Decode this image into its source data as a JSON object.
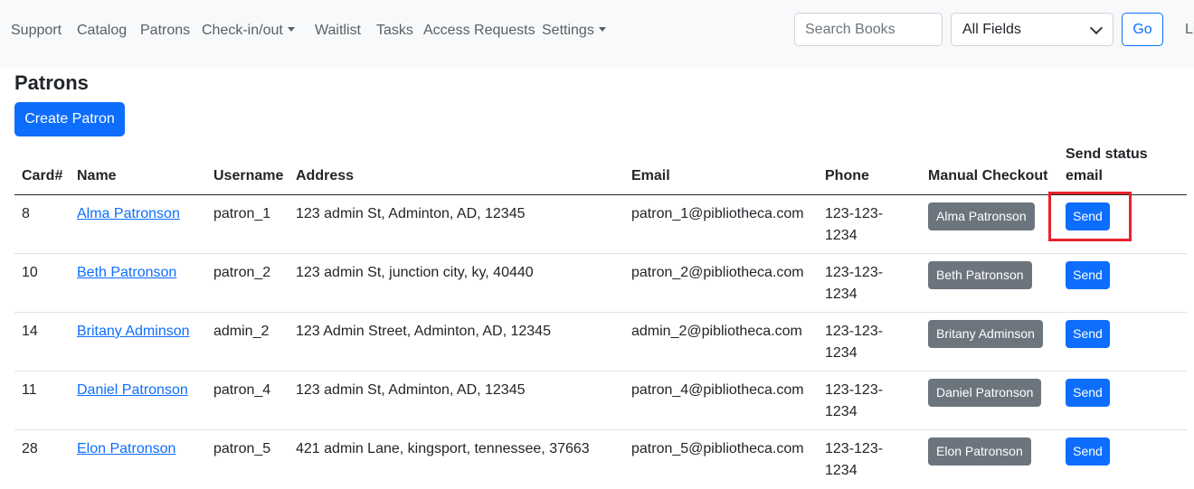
{
  "navbar": {
    "items": [
      {
        "label": "Support",
        "dropdown": false
      },
      {
        "label": "Catalog",
        "dropdown": false
      },
      {
        "label": "Patrons",
        "dropdown": false
      },
      {
        "label": "Check-in/out",
        "dropdown": true
      },
      {
        "label": "Waitlist",
        "dropdown": false
      },
      {
        "label": "Tasks",
        "dropdown": false
      },
      {
        "label": "Access Requests",
        "dropdown": false
      },
      {
        "label": "Settings",
        "dropdown": true
      }
    ],
    "search_placeholder": "Search Books",
    "field_select_value": "All Fields",
    "go_label": "Go",
    "truncated_item": "Li"
  },
  "page": {
    "title": "Patrons",
    "create_button": "Create Patron"
  },
  "table": {
    "headers": {
      "card": "Card#",
      "name": "Name",
      "username": "Username",
      "address": "Address",
      "email": "Email",
      "phone": "Phone",
      "manual_checkout": "Manual Checkout",
      "send_status_line1": "Send status",
      "send_status_line2": "email"
    },
    "rows": [
      {
        "card": "8",
        "name": "Alma Patronson",
        "username": "patron_1",
        "address": "123 admin St, Adminton, AD, 12345",
        "email": "patron_1@pibliotheca.com",
        "phone": "123-123-1234",
        "checkout_label": "Alma Patronson",
        "send_label": "Send"
      },
      {
        "card": "10",
        "name": "Beth Patronson",
        "username": "patron_2",
        "address": "123 admin St, junction city, ky, 40440",
        "email": "patron_2@pibliotheca.com",
        "phone": "123-123-1234",
        "checkout_label": "Beth Patronson",
        "send_label": "Send"
      },
      {
        "card": "14",
        "name": "Britany Adminson",
        "username": "admin_2",
        "address": "123 Admin Street, Adminton, AD, 12345",
        "email": "admin_2@pibliotheca.com",
        "phone": "123-123-1234",
        "checkout_label": "Britany Adminson",
        "send_label": "Send"
      },
      {
        "card": "11",
        "name": "Daniel Patronson",
        "username": "patron_4",
        "address": "123 admin St, Adminton, AD, 12345",
        "email": "patron_4@pibliotheca.com",
        "phone": "123-123-1234",
        "checkout_label": "Daniel Patronson",
        "send_label": "Send"
      },
      {
        "card": "28",
        "name": "Elon Patronson",
        "username": "patron_5",
        "address": "421 admin Lane, kingsport, tennessee, 37663",
        "email": "patron_5@pibliotheca.com",
        "phone": "123-123-1234",
        "checkout_label": "Elon Patronson",
        "send_label": "Send"
      }
    ]
  },
  "colors": {
    "primary": "#0d6efd",
    "secondary": "#6c757d",
    "highlight": "#e8212b",
    "navbar_bg": "#f8f9fa"
  }
}
